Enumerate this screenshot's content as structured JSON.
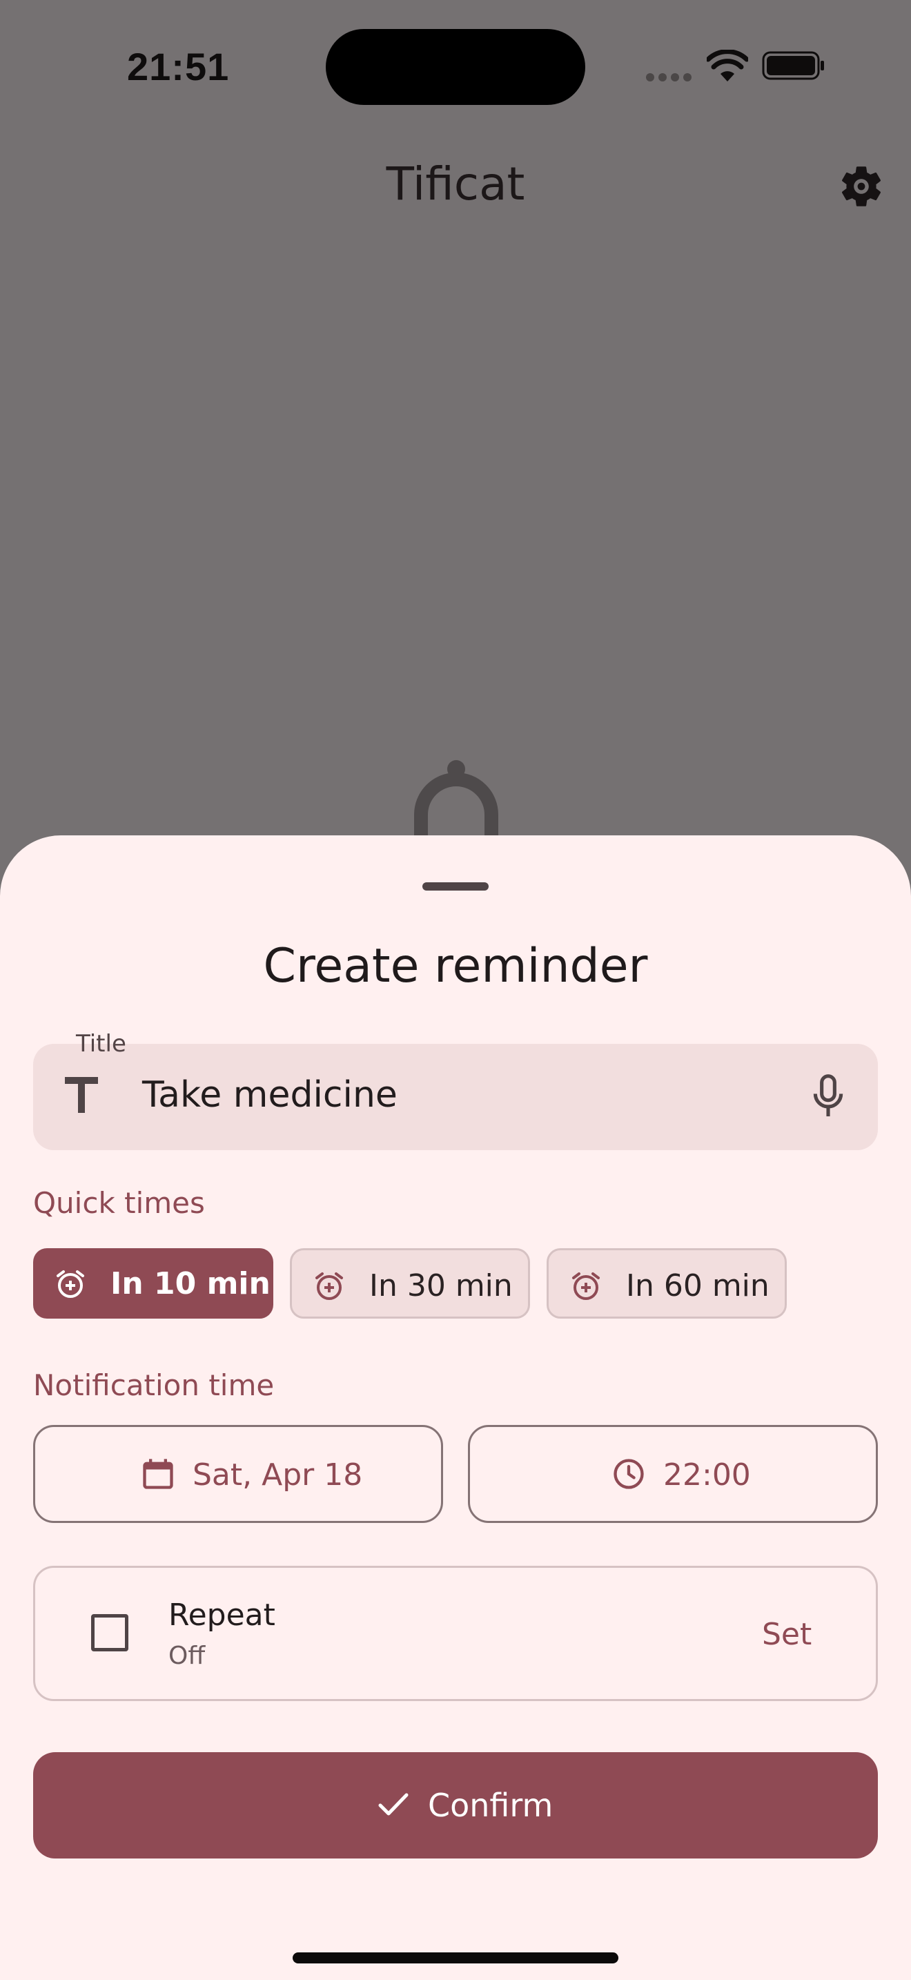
{
  "status_bar": {
    "time": "21:51",
    "icons": [
      "cellular-dots-icon",
      "wifi-icon",
      "battery-icon"
    ]
  },
  "app_bar": {
    "title": "Tificat",
    "settings_icon": "gear-icon"
  },
  "sheet": {
    "title": "Create reminder",
    "title_field": {
      "label": "Title",
      "value": "Take medicine",
      "leading_icon": "text-t-icon",
      "trailing_icon": "microphone-icon"
    },
    "quick_times": {
      "label": "Quick times",
      "chips": [
        {
          "label": "In 10 min",
          "selected": true,
          "icon": "alarm-add-icon"
        },
        {
          "label": "In 30 min",
          "selected": false,
          "icon": "alarm-add-icon"
        },
        {
          "label": "In 60 min",
          "selected": false,
          "icon": "alarm-add-icon"
        }
      ]
    },
    "notification_time": {
      "label": "Notification time",
      "date": "Sat, Apr 18",
      "time": "22:00"
    },
    "repeat": {
      "label": "Repeat",
      "status": "Off",
      "checked": false,
      "action": "Set"
    },
    "confirm_label": "Confirm"
  },
  "colors": {
    "primary": "#8f4a54",
    "sheet_background": "#fff0f0",
    "field_background": "#f2dede",
    "scrim": "#757172"
  }
}
